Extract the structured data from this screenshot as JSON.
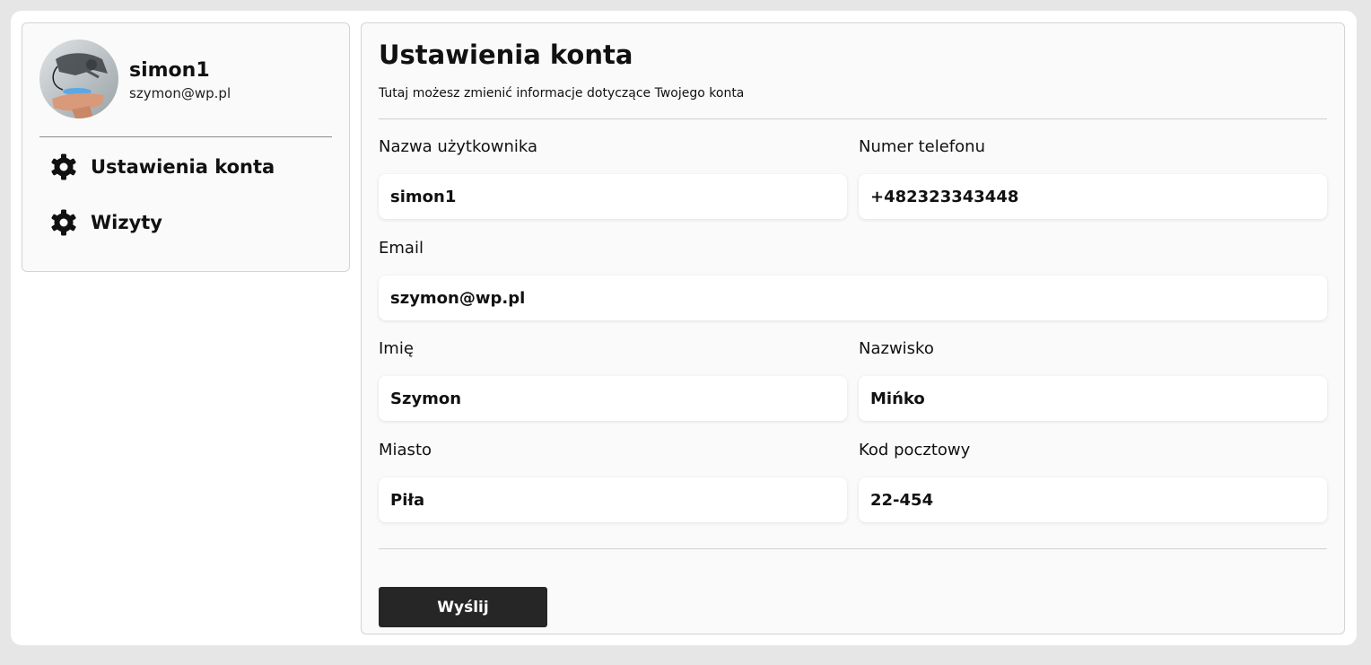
{
  "profile": {
    "username": "simon1",
    "email": "szymon@wp.pl"
  },
  "sidebar": {
    "items": [
      {
        "label": "Ustawienia konta",
        "icon": "gear-icon"
      },
      {
        "label": "Wizyty",
        "icon": "gear-icon"
      }
    ]
  },
  "main": {
    "title": "Ustawienia konta",
    "subtitle": "Tutaj możesz zmienić informacje dotyczące Twojego konta",
    "fields": {
      "username": {
        "label": "Nazwa użytkownika",
        "value": "simon1"
      },
      "phone": {
        "label": "Numer telefonu",
        "value": "+482323343448"
      },
      "email": {
        "label": "Email",
        "value": "szymon@wp.pl"
      },
      "first_name": {
        "label": "Imię",
        "value": "Szymon"
      },
      "last_name": {
        "label": "Nazwisko",
        "value": "Mińko"
      },
      "city": {
        "label": "Miasto",
        "value": "Piła"
      },
      "postal_code": {
        "label": "Kod pocztowy",
        "value": "22-454"
      }
    },
    "submit_label": "Wyślij"
  },
  "colors": {
    "page_background": "#e6e6e6",
    "card_background": "#fafafa",
    "button_background": "#262626",
    "button_text": "#ffffff"
  }
}
